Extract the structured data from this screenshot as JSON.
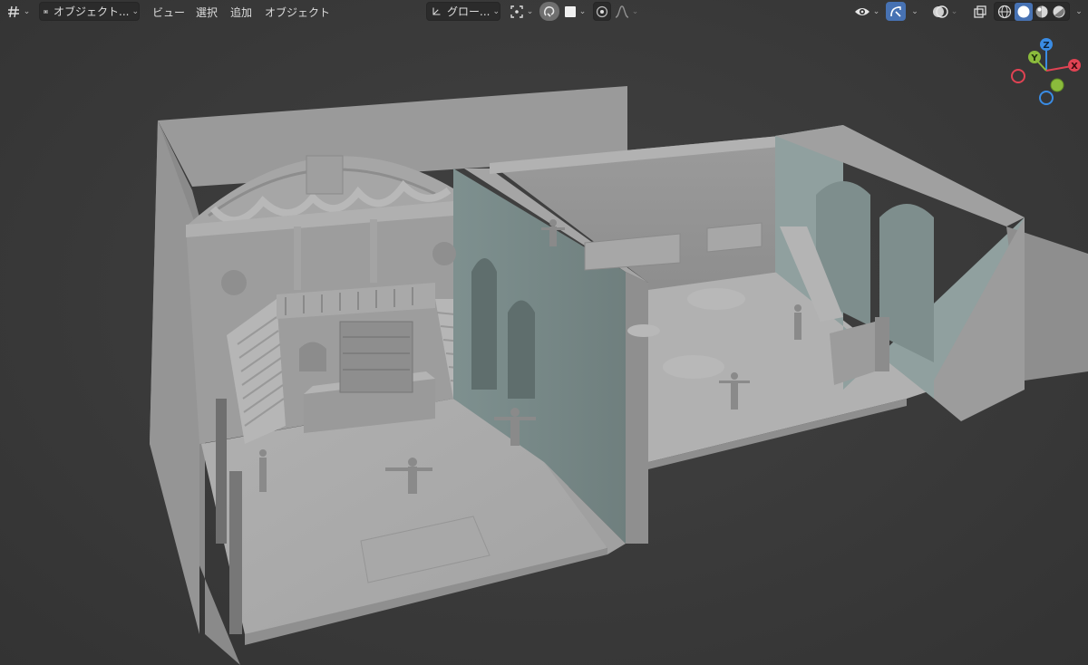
{
  "header": {
    "editor_type_icon": "viewport-editor-icon",
    "mode": {
      "label": "オブジェクト...",
      "icon": "object-mode-icon"
    },
    "menus": [
      "ビュー",
      "選択",
      "追加",
      "オブジェクト"
    ],
    "transform_orientation": {
      "label": "グロー...",
      "icon": "transform-orientation-icon"
    },
    "pivot_icon": "pivot-point-icon",
    "snap_icon": "snap-icon",
    "snap_target_icon": "snap-target-square-icon",
    "proportional_edit_icon": "proportional-editing-icon",
    "falloff_icon": "falloff-curve-icon",
    "visibility_icon": "object-visibility-eye-icon",
    "gizmo_toggle_icon": "gizmo-toggle-icon",
    "overlay_icon": "overlay-icon",
    "xray_icon": "xray-toggle-icon",
    "shading_modes": [
      "wireframe-shading-icon",
      "solid-shading-icon",
      "material-preview-icon",
      "rendered-shading-icon"
    ],
    "active_shading": "solid-shading-icon"
  },
  "navigation_gizmo": {
    "axes": [
      "Z",
      "Y",
      "X"
    ],
    "colors": {
      "x": "#e04353",
      "y": "#8bbb3c",
      "z": "#3a8ce4"
    }
  },
  "colors": {
    "viewport_bg": "#3a3a3a",
    "accent_active": "#4772b3",
    "model_light": "#a8a8a8",
    "model_mid": "#8e8e8e",
    "model_teal": "#7d8f8e"
  }
}
